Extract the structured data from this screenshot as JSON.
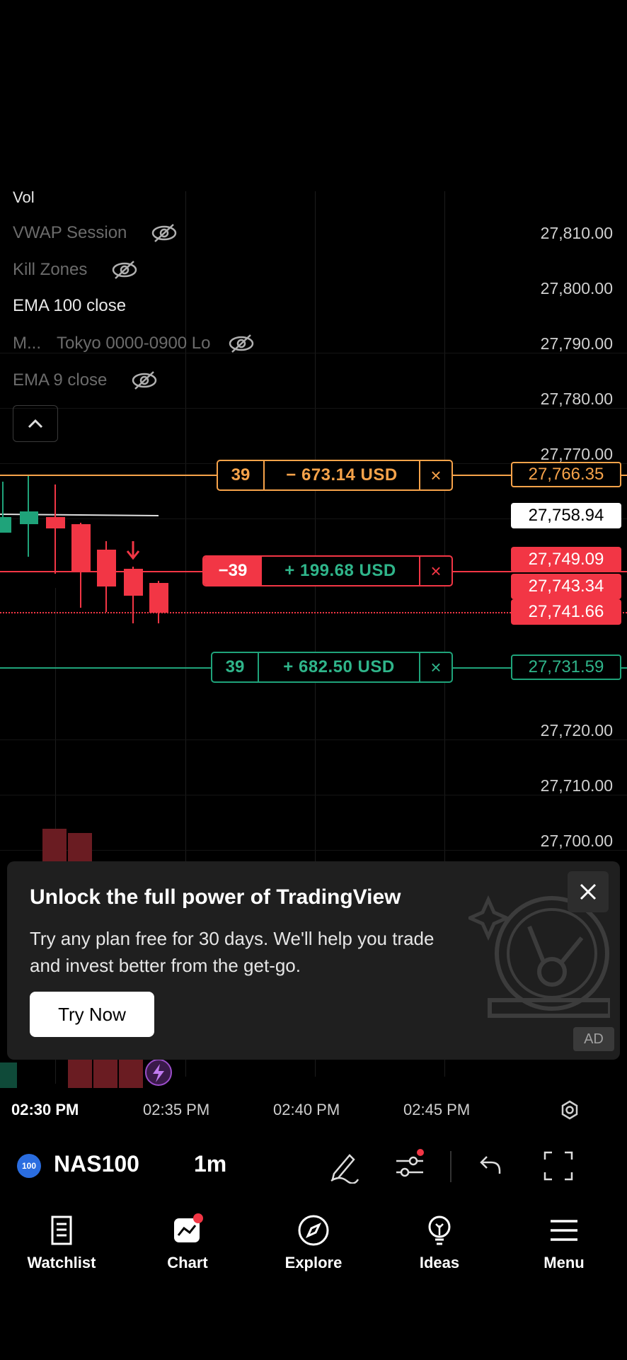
{
  "legend": {
    "vol": "Vol",
    "vwap": "VWAP Session",
    "kill_zones": "Kill Zones",
    "ema100": "EMA 100 close",
    "m_prefix": "M...",
    "tokyo": "Tokyo 0000-0900 Lo",
    "ema9": "EMA 9 close"
  },
  "price_axis": [
    "27,810.00",
    "27,800.00",
    "27,790.00",
    "27,780.00",
    "27,770.00",
    "27,720.00",
    "27,710.00",
    "27,700.00"
  ],
  "orders": {
    "take_loss": {
      "qty": "39",
      "pnl": "− 673.14 USD",
      "close": "×",
      "price": "27,766.35"
    },
    "position": {
      "qty": "−39",
      "pnl": "+ 199.68 USD",
      "close": "×",
      "price": "27,749.09"
    },
    "take_profit": {
      "qty": "39",
      "pnl": "+ 682.50 USD",
      "close": "×",
      "price": "27,731.59"
    }
  },
  "price_tags": {
    "current": "27,758.94",
    "bid": "27,743.34",
    "ask": "27,741.66"
  },
  "time_axis": [
    "02:30 PM",
    "02:35 PM",
    "02:40 PM",
    "02:45 PM"
  ],
  "ad": {
    "title": "Unlock the full power of TradingView",
    "body": "Try any plan free for 30 days. We'll help you trade and invest better from the get-go.",
    "button": "Try Now",
    "badge": "AD"
  },
  "toolbar": {
    "badge": "100",
    "symbol": "NAS100",
    "interval": "1m"
  },
  "nav": [
    {
      "label": "Watchlist",
      "icon": "watchlist-icon"
    },
    {
      "label": "Chart",
      "icon": "chart-icon"
    },
    {
      "label": "Explore",
      "icon": "compass-icon"
    },
    {
      "label": "Ideas",
      "icon": "lightbulb-icon"
    },
    {
      "label": "Menu",
      "icon": "hamburger-icon"
    }
  ],
  "colors": {
    "up": "#1fa37a",
    "down": "#f23645",
    "orange": "#f7a34a",
    "bg": "#000000"
  }
}
